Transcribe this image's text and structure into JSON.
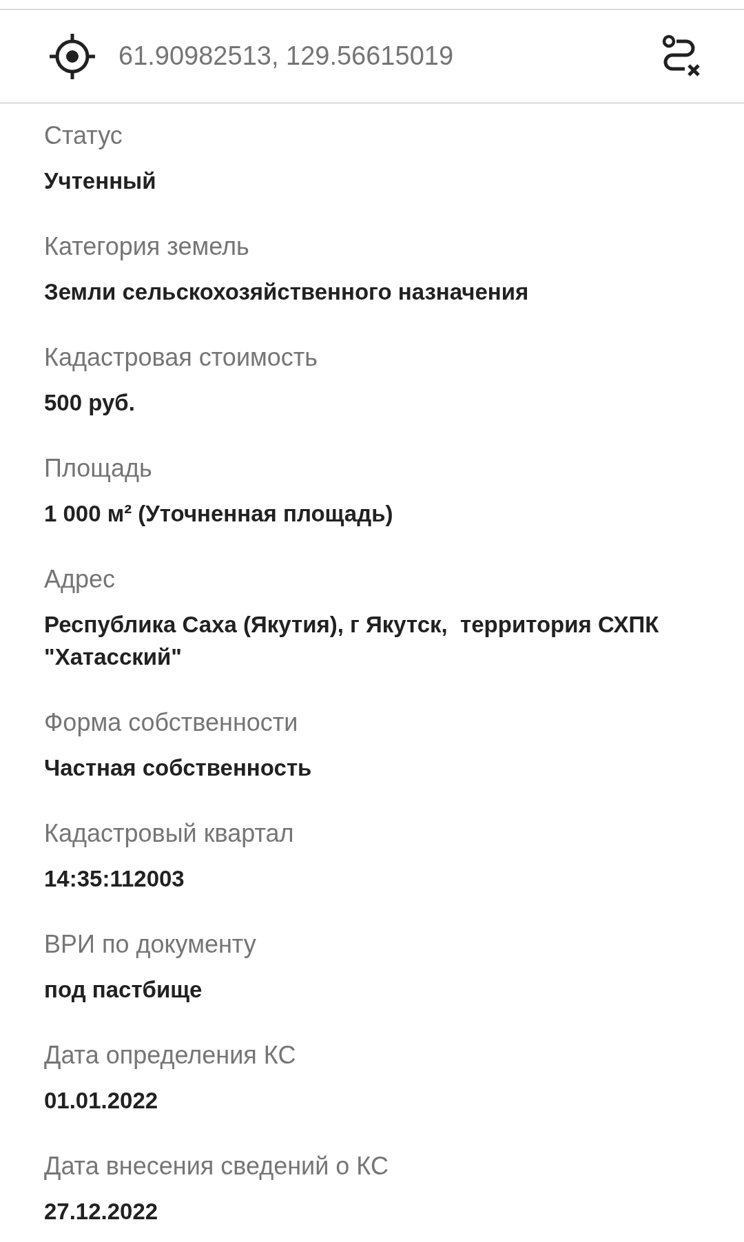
{
  "location_bar": {
    "coordinates": "61.90982513, 129.56615019"
  },
  "fields": [
    {
      "label": "Статус",
      "value": "Учтенный"
    },
    {
      "label": "Категория земель",
      "value": "Земли сельскохозяйственного назначения"
    },
    {
      "label": "Кадастровая стоимость",
      "value": "500 руб."
    },
    {
      "label": "Площадь",
      "value": "1 000 м² (Уточненная площадь)"
    },
    {
      "label": "Адрес",
      "value": "Республика Саха (Якутия), г Якутск,  территория СХПК \"Хатасский\""
    },
    {
      "label": "Форма собственности",
      "value": "Частная собственность"
    },
    {
      "label": "Кадастровый квартал",
      "value": "14:35:112003"
    },
    {
      "label": "ВРИ по документу",
      "value": "под пастбище"
    },
    {
      "label": "Дата определения КС",
      "value": "01.01.2022"
    },
    {
      "label": "Дата внесения сведений о КС",
      "value": "27.12.2022"
    }
  ]
}
